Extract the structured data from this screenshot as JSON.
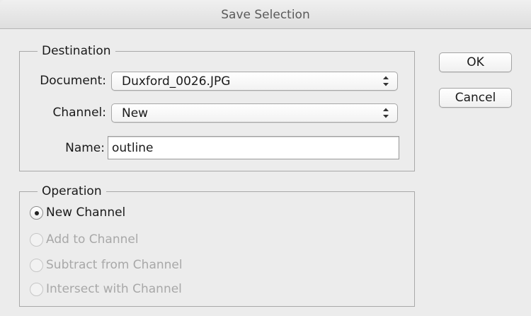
{
  "window": {
    "title": "Save Selection"
  },
  "destination": {
    "legend": "Destination",
    "document_label": "Document:",
    "document_value": "Duxford_0026.JPG",
    "channel_label": "Channel:",
    "channel_value": "New",
    "name_label": "Name:",
    "name_value": "outline"
  },
  "operation": {
    "legend": "Operation",
    "options": [
      {
        "label": "New Channel",
        "selected": true,
        "enabled": true
      },
      {
        "label": "Add to Channel",
        "selected": false,
        "enabled": false
      },
      {
        "label": "Subtract from Channel",
        "selected": false,
        "enabled": false
      },
      {
        "label": "Intersect with Channel",
        "selected": false,
        "enabled": false
      }
    ]
  },
  "buttons": {
    "ok": "OK",
    "cancel": "Cancel"
  },
  "icons": {
    "select_arrows": "updown-arrows-icon",
    "radio_selected": "radio-dot-icon"
  }
}
